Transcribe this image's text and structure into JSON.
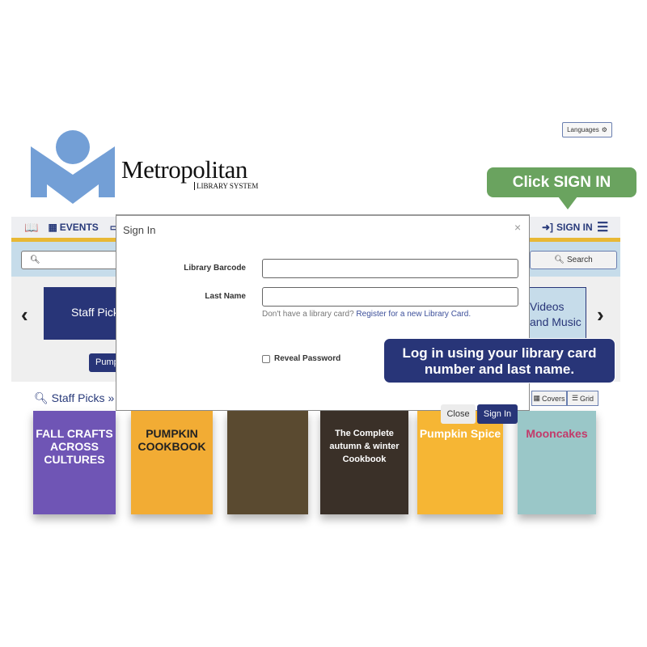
{
  "header": {
    "languages_label": "Languages",
    "logo": {
      "name": "Metropolitan",
      "sub": "LIBRARY SYSTEM"
    }
  },
  "callouts": {
    "sign_in_hint": "Click SIGN IN",
    "login_hint": "Log in using your library card number and last name."
  },
  "nav": {
    "events": "EVENTS",
    "sign_in": "SIGN IN"
  },
  "search": {
    "button": "Search",
    "placeholder": ""
  },
  "carousel": {
    "staff_picks": "Staff Picks",
    "videos": "Videos and Music",
    "pumpkin_button": "Pump"
  },
  "breadcrumb": {
    "text": "Staff Picks » P"
  },
  "view": {
    "covers": "Covers",
    "grid": "Grid"
  },
  "books": [
    {
      "title": "FALL CRAFTS ACROSS CULTURES",
      "color": "#6f55b5"
    },
    {
      "title": "PUMPKIN COOKBOOK",
      "color": "#f2ac34"
    },
    {
      "title": "",
      "color": "#5a4a30"
    },
    {
      "title": "The Complete autumn & winter Cookbook",
      "color": "#3a3028"
    },
    {
      "title": "Pumpkin Spice",
      "color": "#f6b634"
    },
    {
      "title": "Mooncakes",
      "color": "#9ac7c8"
    }
  ],
  "modal": {
    "title": "Sign In",
    "close_x": "×",
    "barcode_label": "Library Barcode",
    "barcode_value": "",
    "lastname_label": "Last Name",
    "lastname_value": "",
    "help_text": "Don't have a library card?",
    "help_link": "Register for a new Library Card.",
    "reveal_label": "Reveal Password",
    "close_button": "Close",
    "sign_in_button": "Sign In"
  },
  "colors": {
    "brand_navy": "#283578",
    "gold": "#e8b835",
    "callout_green": "#6aa35f",
    "logo_blue": "#739fd6"
  }
}
